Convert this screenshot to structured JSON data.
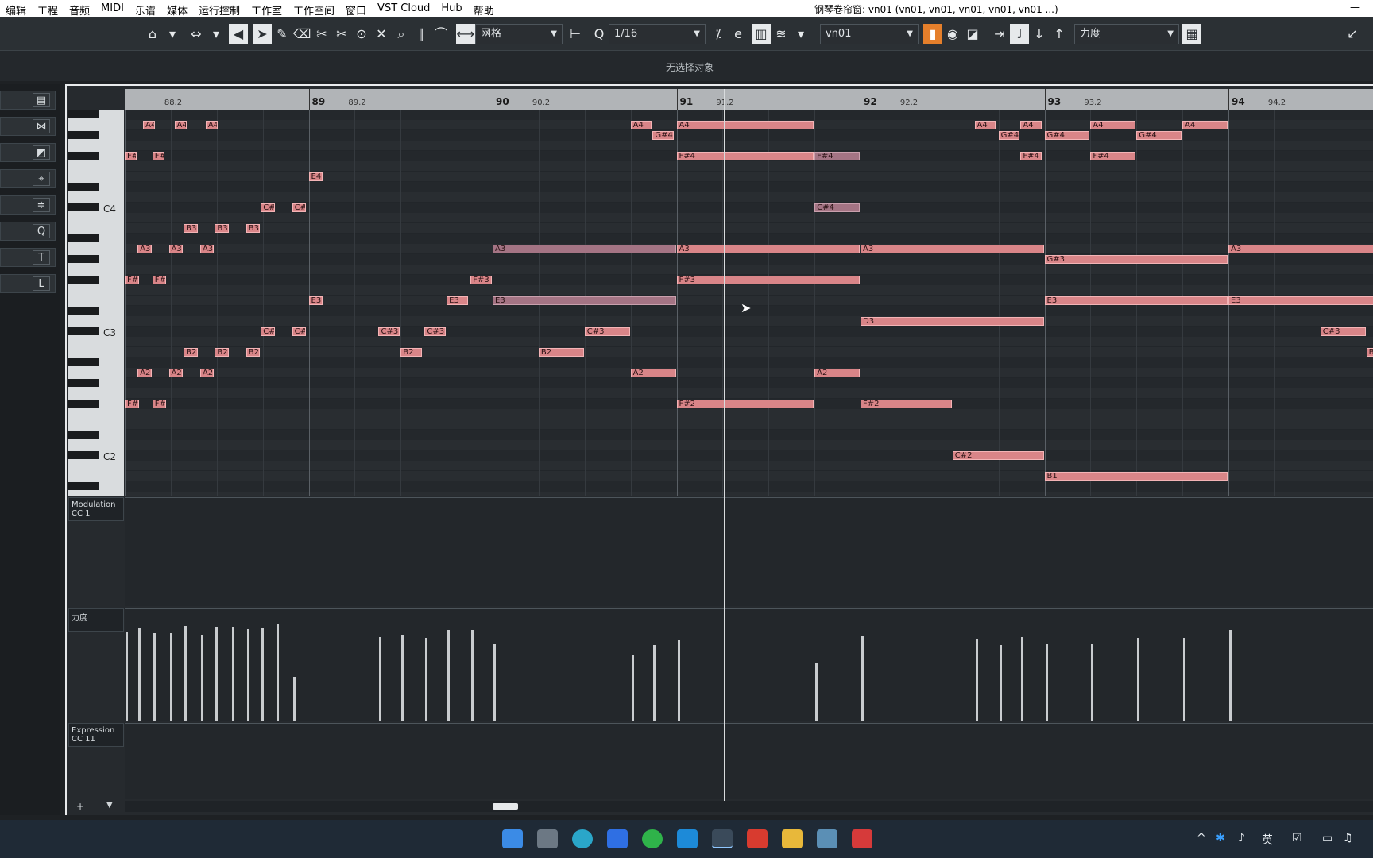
{
  "menu": [
    "编辑",
    "工程",
    "音频",
    "MIDI",
    "乐谱",
    "媒体",
    "运行控制",
    "工作室",
    "工作空间",
    "窗口",
    "VST Cloud",
    "Hub",
    "帮助"
  ],
  "window_title": "钢琴卷帘窗: vn01 (vn01, vn01, vn01, vn01, vn01 ...)",
  "toolbar": {
    "grid_type": "网格",
    "quantize_value": "1/16",
    "track_name": "vn01",
    "controller_lane": "力度"
  },
  "info_line": "无选择对象",
  "ruler": {
    "bars": [
      "89",
      "90",
      "91",
      "92",
      "93",
      "94"
    ],
    "subs": [
      "88.2",
      "89.2",
      "90.2",
      "91.2",
      "92.2",
      "93.2",
      "94.2"
    ]
  },
  "keyboard_labels": [
    "C4",
    "C3",
    "C2"
  ],
  "lanes": {
    "modulation": "Modulation\nCC 1",
    "velocity": "力度",
    "expression": "Expression\nCC 11"
  },
  "notes": [
    {
      "pitch": "A4",
      "start": 88.1,
      "len": 0.07
    },
    {
      "pitch": "A4",
      "start": 88.27,
      "len": 0.07
    },
    {
      "pitch": "A4",
      "start": 88.44,
      "len": 0.07
    },
    {
      "pitch": "F#4",
      "start": 88.0,
      "len": 0.07
    },
    {
      "pitch": "F#4",
      "start": 88.15,
      "len": 0.07
    },
    {
      "pitch": "E4",
      "start": 89.0,
      "len": 0.08
    },
    {
      "pitch": "C#4",
      "start": 88.74,
      "len": 0.08
    },
    {
      "pitch": "C#4",
      "start": 88.91,
      "len": 0.08
    },
    {
      "pitch": "B3",
      "start": 88.32,
      "len": 0.08
    },
    {
      "pitch": "B3",
      "start": 88.49,
      "len": 0.08
    },
    {
      "pitch": "B3",
      "start": 88.66,
      "len": 0.08
    },
    {
      "pitch": "A3",
      "start": 88.07,
      "len": 0.08
    },
    {
      "pitch": "A3",
      "start": 88.24,
      "len": 0.08
    },
    {
      "pitch": "A3",
      "start": 88.41,
      "len": 0.08
    },
    {
      "pitch": "F#3",
      "start": 88.0,
      "len": 0.08
    },
    {
      "pitch": "F#3",
      "start": 88.15,
      "len": 0.08
    },
    {
      "pitch": "E3",
      "start": 89.0,
      "len": 0.08
    },
    {
      "pitch": "C#3",
      "start": 88.74,
      "len": 0.08
    },
    {
      "pitch": "C#3",
      "start": 88.91,
      "len": 0.08
    },
    {
      "pitch": "B2",
      "start": 88.32,
      "len": 0.08
    },
    {
      "pitch": "B2",
      "start": 88.49,
      "len": 0.08
    },
    {
      "pitch": "B2",
      "start": 88.66,
      "len": 0.08
    },
    {
      "pitch": "A2",
      "start": 88.07,
      "len": 0.08
    },
    {
      "pitch": "A2",
      "start": 88.24,
      "len": 0.08
    },
    {
      "pitch": "A2",
      "start": 88.41,
      "len": 0.08
    },
    {
      "pitch": "F#2",
      "start": 88.0,
      "len": 0.08
    },
    {
      "pitch": "F#2",
      "start": 88.15,
      "len": 0.08
    },
    {
      "pitch": "C#3",
      "start": 89.38,
      "len": 0.12
    },
    {
      "pitch": "C#3",
      "start": 89.63,
      "len": 0.12
    },
    {
      "pitch": "B2",
      "start": 89.5,
      "len": 0.12
    },
    {
      "pitch": "E3",
      "start": 89.75,
      "len": 0.12
    },
    {
      "pitch": "F#3",
      "start": 89.88,
      "len": 0.12
    },
    {
      "pitch": "E3",
      "start": 90.0,
      "len": 1.0,
      "dim": true
    },
    {
      "pitch": "A3",
      "start": 90.0,
      "len": 1.0,
      "dim": true
    },
    {
      "pitch": "B2",
      "start": 90.25,
      "len": 0.25
    },
    {
      "pitch": "C#3",
      "start": 90.5,
      "len": 0.25
    },
    {
      "pitch": "A2",
      "start": 90.75,
      "len": 0.25
    },
    {
      "pitch": "A4",
      "start": 90.75,
      "len": 0.12
    },
    {
      "pitch": "G#4",
      "start": 90.87,
      "len": 0.12
    },
    {
      "pitch": "A4",
      "start": 91.0,
      "len": 0.75
    },
    {
      "pitch": "F#4",
      "start": 91.0,
      "len": 0.75
    },
    {
      "pitch": "F#4",
      "start": 91.75,
      "len": 0.25,
      "dim": true
    },
    {
      "pitch": "C#4",
      "start": 91.75,
      "len": 0.25,
      "dim": true
    },
    {
      "pitch": "A3",
      "start": 91.0,
      "len": 1.0
    },
    {
      "pitch": "F#3",
      "start": 91.0,
      "len": 1.0
    },
    {
      "pitch": "A2",
      "start": 91.75,
      "len": 0.25
    },
    {
      "pitch": "F#2",
      "start": 91.0,
      "len": 0.75
    },
    {
      "pitch": "A3",
      "start": 92.0,
      "len": 1.0
    },
    {
      "pitch": "D3",
      "start": 92.0,
      "len": 1.0
    },
    {
      "pitch": "F#2",
      "start": 92.0,
      "len": 0.5
    },
    {
      "pitch": "C#2",
      "start": 92.5,
      "len": 0.5
    },
    {
      "pitch": "A4",
      "start": 92.62,
      "len": 0.12
    },
    {
      "pitch": "G#4",
      "start": 92.75,
      "len": 0.12
    },
    {
      "pitch": "A4",
      "start": 92.87,
      "len": 0.12
    },
    {
      "pitch": "F#4",
      "start": 92.87,
      "len": 0.12
    },
    {
      "pitch": "G#4",
      "start": 93.0,
      "len": 0.25
    },
    {
      "pitch": "A4",
      "start": 93.25,
      "len": 0.25
    },
    {
      "pitch": "F#4",
      "start": 93.25,
      "len": 0.25
    },
    {
      "pitch": "G#4",
      "start": 93.5,
      "len": 0.25
    },
    {
      "pitch": "A4",
      "start": 93.75,
      "len": 0.25
    },
    {
      "pitch": "G#3",
      "start": 93.0,
      "len": 1.0
    },
    {
      "pitch": "E3",
      "start": 93.0,
      "len": 1.0
    },
    {
      "pitch": "B1",
      "start": 93.0,
      "len": 1.0
    },
    {
      "pitch": "A3",
      "start": 94.0,
      "len": 1.0
    },
    {
      "pitch": "E3",
      "start": 94.0,
      "len": 1.0
    },
    {
      "pitch": "C#3",
      "start": 94.5,
      "len": 0.25
    },
    {
      "pitch": "B2",
      "start": 94.75,
      "len": 0.25
    }
  ],
  "velocities": [
    {
      "t": 88.0,
      "v": 0.88
    },
    {
      "t": 88.07,
      "v": 0.92
    },
    {
      "t": 88.15,
      "v": 0.87
    },
    {
      "t": 88.24,
      "v": 0.87
    },
    {
      "t": 88.32,
      "v": 0.94
    },
    {
      "t": 88.41,
      "v": 0.85
    },
    {
      "t": 88.49,
      "v": 0.93
    },
    {
      "t": 88.58,
      "v": 0.93
    },
    {
      "t": 88.66,
      "v": 0.91
    },
    {
      "t": 88.74,
      "v": 0.92
    },
    {
      "t": 88.82,
      "v": 0.96
    },
    {
      "t": 88.91,
      "v": 0.44
    },
    {
      "t": 89.38,
      "v": 0.83
    },
    {
      "t": 89.5,
      "v": 0.85
    },
    {
      "t": 89.63,
      "v": 0.82
    },
    {
      "t": 89.75,
      "v": 0.9
    },
    {
      "t": 89.88,
      "v": 0.9
    },
    {
      "t": 90.0,
      "v": 0.76
    },
    {
      "t": 90.75,
      "v": 0.66
    },
    {
      "t": 90.87,
      "v": 0.75
    },
    {
      "t": 91.0,
      "v": 0.8
    },
    {
      "t": 91.75,
      "v": 0.57
    },
    {
      "t": 92.0,
      "v": 0.84
    },
    {
      "t": 92.62,
      "v": 0.81
    },
    {
      "t": 92.75,
      "v": 0.75
    },
    {
      "t": 92.87,
      "v": 0.83
    },
    {
      "t": 93.0,
      "v": 0.76
    },
    {
      "t": 93.25,
      "v": 0.76
    },
    {
      "t": 93.5,
      "v": 0.82
    },
    {
      "t": 93.75,
      "v": 0.82
    },
    {
      "t": 94.0,
      "v": 0.9
    }
  ],
  "taskbar_apps": [
    "windows-start",
    "task-view",
    "edge",
    "notes",
    "wechat",
    "app-u",
    "cubase",
    "wps",
    "explorer",
    "photos",
    "recorder"
  ],
  "tray": {
    "ime": "英"
  }
}
